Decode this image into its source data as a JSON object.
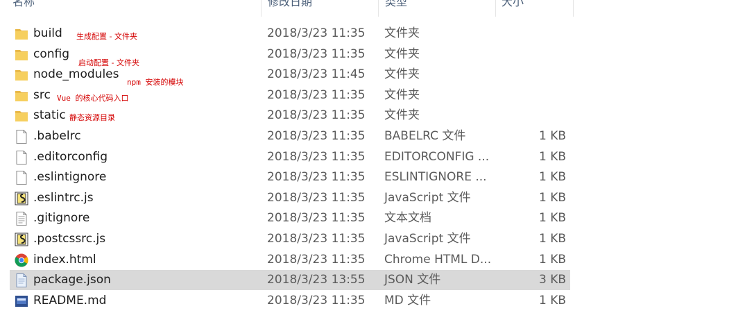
{
  "columns": {
    "name": "名称",
    "date": "修改日期",
    "type": "类型",
    "size": "大小"
  },
  "files": [
    {
      "name": "build",
      "date": "2018/3/23 11:35",
      "type": "文件夹",
      "size": "",
      "icon": "folder-icon"
    },
    {
      "name": "config",
      "date": "2018/3/23 11:35",
      "type": "文件夹",
      "size": "",
      "icon": "folder-icon"
    },
    {
      "name": "node_modules",
      "date": "2018/3/23 11:45",
      "type": "文件夹",
      "size": "",
      "icon": "folder-icon"
    },
    {
      "name": "src",
      "date": "2018/3/23 11:35",
      "type": "文件夹",
      "size": "",
      "icon": "folder-icon"
    },
    {
      "name": "static",
      "date": "2018/3/23 11:35",
      "type": "文件夹",
      "size": "",
      "icon": "folder-icon"
    },
    {
      "name": ".babelrc",
      "date": "2018/3/23 11:35",
      "type": "BABELRC 文件",
      "size": "1 KB",
      "icon": "file-icon"
    },
    {
      "name": ".editorconfig",
      "date": "2018/3/23 11:35",
      "type": "EDITORCONFIG ...",
      "size": "1 KB",
      "icon": "file-icon"
    },
    {
      "name": ".eslintignore",
      "date": "2018/3/23 11:35",
      "type": "ESLINTIGNORE ...",
      "size": "1 KB",
      "icon": "file-icon"
    },
    {
      "name": ".eslintrc.js",
      "date": "2018/3/23 11:35",
      "type": "JavaScript 文件",
      "size": "1 KB",
      "icon": "js-script-icon"
    },
    {
      "name": ".gitignore",
      "date": "2018/3/23 11:35",
      "type": "文本文档",
      "size": "1 KB",
      "icon": "text-file-icon"
    },
    {
      "name": ".postcssrc.js",
      "date": "2018/3/23 11:35",
      "type": "JavaScript 文件",
      "size": "1 KB",
      "icon": "js-script-icon"
    },
    {
      "name": "index.html",
      "date": "2018/3/23 11:35",
      "type": "Chrome HTML D...",
      "size": "1 KB",
      "icon": "chrome-icon"
    },
    {
      "name": "package.json",
      "date": "2018/3/23 13:55",
      "type": "JSON 文件",
      "size": "3 KB",
      "icon": "json-file-icon",
      "selected": true
    },
    {
      "name": "README.md",
      "date": "2018/3/23 11:35",
      "type": "MD 文件",
      "size": "1 KB",
      "icon": "md-file-icon"
    }
  ],
  "annotations": {
    "build": "生成配置 - 文件夹",
    "config": "启动配置 - 文件夹",
    "node_modules": "npm 安装的模块",
    "src": "Vue 的核心代码入口",
    "static": "静态资源目录"
  },
  "colors": {
    "annotation": "#d40000",
    "selected_row": "#d9d9d9",
    "folder": "#f6cf5f"
  }
}
